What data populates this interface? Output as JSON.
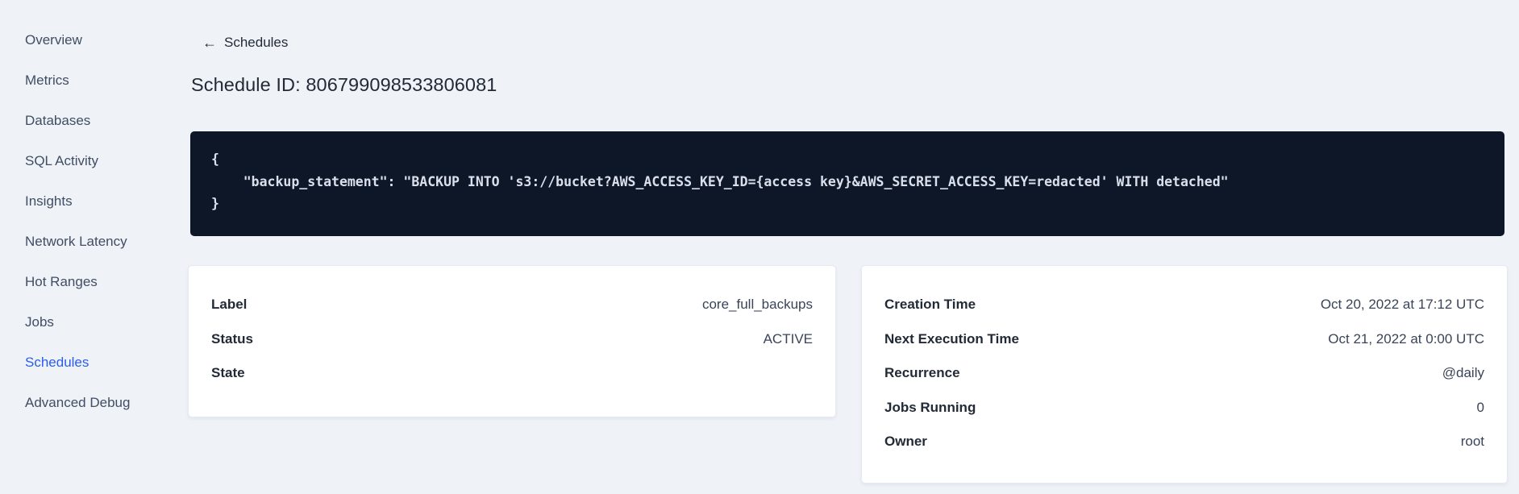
{
  "sidebar": {
    "items": [
      {
        "label": "Overview"
      },
      {
        "label": "Metrics"
      },
      {
        "label": "Databases"
      },
      {
        "label": "SQL Activity"
      },
      {
        "label": "Insights"
      },
      {
        "label": "Network Latency"
      },
      {
        "label": "Hot Ranges"
      },
      {
        "label": "Jobs"
      },
      {
        "label": "Schedules",
        "active": true
      },
      {
        "label": "Advanced Debug"
      }
    ]
  },
  "header": {
    "back_icon": {
      "name": "arrow-left-icon",
      "glyph": "←"
    },
    "back_label": "Schedules",
    "title": "Schedule ID: 806799098533806081"
  },
  "code_block": {
    "text": "{\n    \"backup_statement\": \"BACKUP INTO 's3://bucket?AWS_ACCESS_KEY_ID={access key}&AWS_SECRET_ACCESS_KEY=redacted' WITH detached\"\n}"
  },
  "schedule_details_card": {
    "rows": [
      {
        "label": "Label",
        "value": "core_full_backups"
      },
      {
        "label": "Status",
        "value": "ACTIVE"
      },
      {
        "label": "State",
        "value": ""
      }
    ]
  },
  "execution_details_card": {
    "rows": [
      {
        "label": "Creation Time",
        "value": "Oct 20, 2022 at 17:12 UTC"
      },
      {
        "label": "Next Execution Time",
        "value": "Oct 21, 2022 at 0:00 UTC"
      },
      {
        "label": "Recurrence",
        "value": "@daily"
      },
      {
        "label": "Jobs Running",
        "value": "0"
      },
      {
        "label": "Owner",
        "value": "root"
      }
    ]
  },
  "colors": {
    "page_background": "#eff3f8",
    "active_link_blue": "#2b5cf0",
    "code_background": "#0e1728",
    "code_text": "#dae0eb",
    "text_primary": "#232a37",
    "text_secondary": "#414d64",
    "card_background": "#ffffff"
  }
}
